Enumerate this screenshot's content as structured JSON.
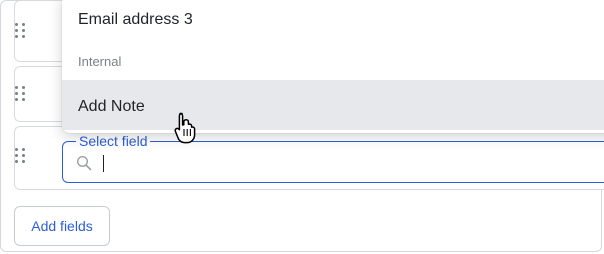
{
  "menu": {
    "options": [
      {
        "label": "Email address 3",
        "type": "option"
      },
      {
        "label": "Internal",
        "type": "group"
      },
      {
        "label": "Add Note",
        "type": "option",
        "hovered": true
      }
    ]
  },
  "select_field": {
    "label": "Select field",
    "value": ""
  },
  "add_fields_label": "Add fields",
  "colors": {
    "accent": "#2b5fd9",
    "hover_bg": "#e6e8eb",
    "border": "#d7dbe0"
  },
  "icons": [
    "drag-handle-icon",
    "search-icon",
    "hand-pointer-cursor-icon"
  ]
}
